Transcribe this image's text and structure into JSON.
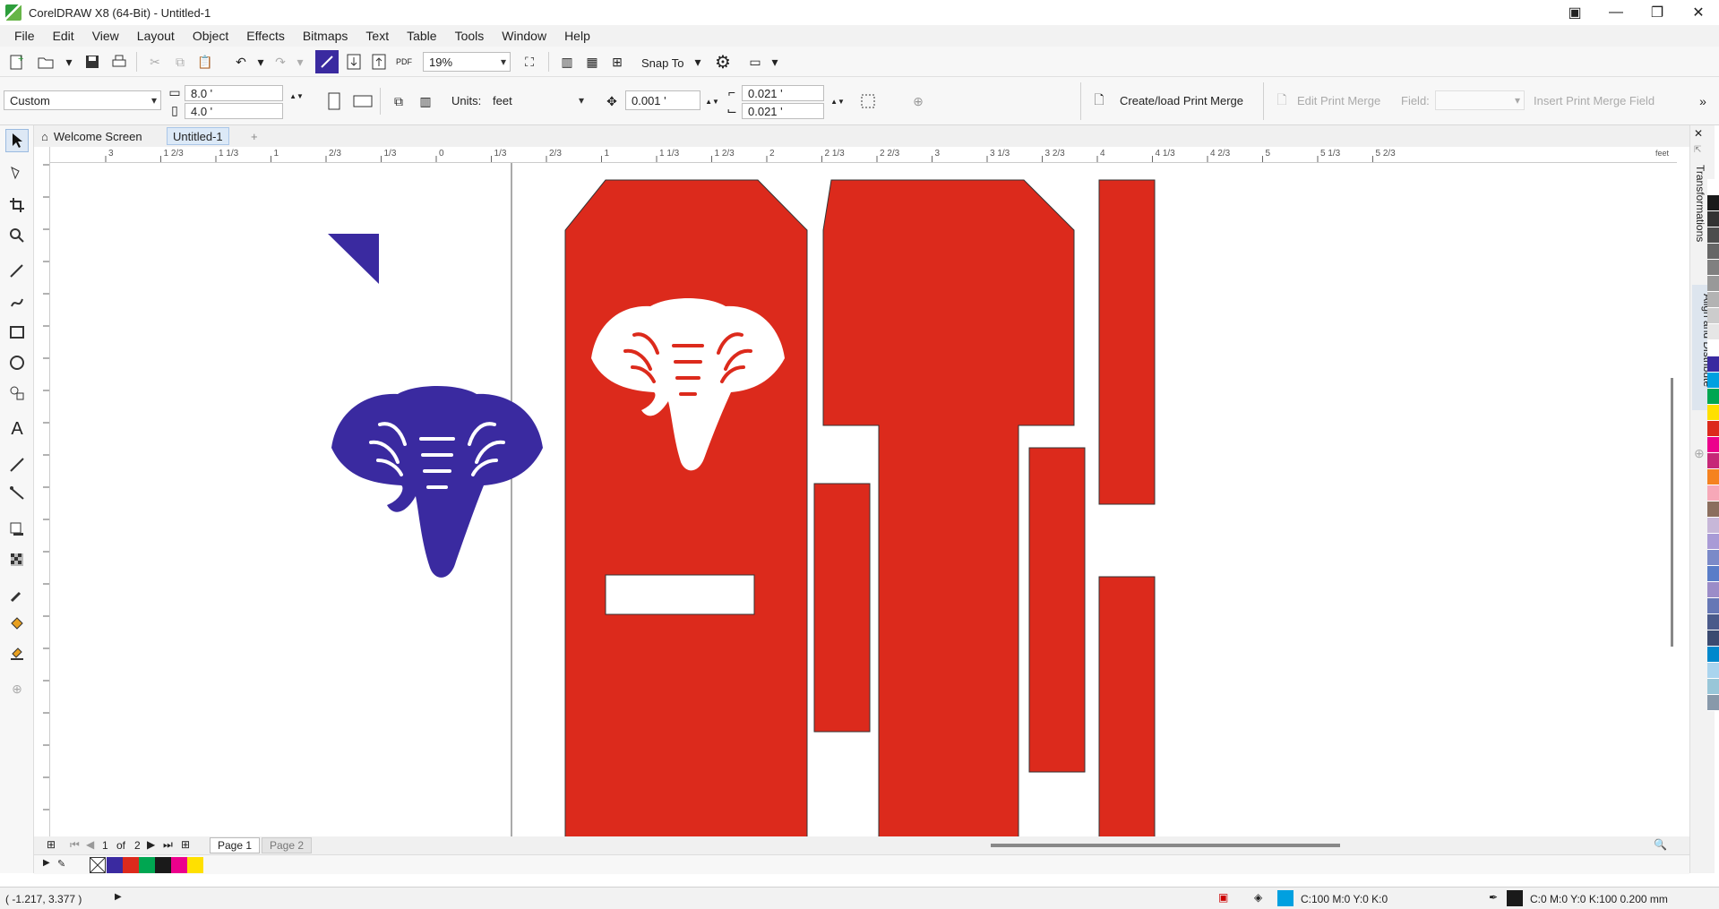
{
  "window": {
    "title": "CorelDRAW X8 (64-Bit) - Untitled-1"
  },
  "menu": [
    "File",
    "Edit",
    "View",
    "Layout",
    "Object",
    "Effects",
    "Bitmaps",
    "Text",
    "Table",
    "Tools",
    "Window",
    "Help"
  ],
  "toolbar": {
    "zoom": "19%",
    "snap_to": "Snap To",
    "pdf_label": "PDF"
  },
  "propertybar": {
    "page_preset": "Custom",
    "width": "8.0 '",
    "height": "4.0 '",
    "units_label": "Units:",
    "units": "feet",
    "nudge": "0.001 '",
    "dup_x": "0.021 '",
    "dup_y": "0.021 '",
    "create_merge": "Create/load Print Merge",
    "edit_merge": "Edit Print Merge",
    "field_label": "Field:",
    "insert_field": "Insert Print Merge Field"
  },
  "tabs": {
    "welcome": "Welcome Screen",
    "doc": "Untitled-1"
  },
  "ruler": {
    "unit": "feet",
    "h_ticks": [
      "3",
      "1 2/3",
      "1 1/3",
      "1",
      "2/3",
      "1/3",
      "0",
      "1/3",
      "2/3",
      "1",
      "1 1/3",
      "1 2/3",
      "2",
      "2 1/3",
      "2 2/3",
      "3",
      "3 1/3",
      "3 2/3",
      "4",
      "4 1/3",
      "4 2/3",
      "5",
      "5 1/3",
      "5 2/3"
    ]
  },
  "dockers": {
    "transformations": "Transformations",
    "align": "Align and Distribute"
  },
  "pages": {
    "current": "1",
    "of_label": "of",
    "total": "2",
    "page1": "Page 1",
    "page2": "Page 2"
  },
  "status": {
    "coords": "( -1.217, 3.377 )",
    "fill": "C:100 M:0 Y:0 K:0",
    "outline": "C:0 M:0 Y:0 K:100  0.200 mm"
  },
  "colors": {
    "red": "#dc2a1c",
    "blue": "#3a2aa0",
    "cyan": "#00a0e0"
  },
  "palette_colors": [
    "#ffffff",
    "#1a1a1a",
    "#333333",
    "#4d4d4d",
    "#666666",
    "#808080",
    "#999999",
    "#b3b3b3",
    "#cccccc",
    "#e6e6e6",
    "#ffffff",
    "#3a2aa0",
    "#00a0e0",
    "#00a651",
    "#ffe000",
    "#dc2a1c",
    "#ec008c",
    "#c62878",
    "#f58220",
    "#f7a8b8",
    "#8b6e5e",
    "#c7b7d8",
    "#a99bd6",
    "#7b8ac8",
    "#5a7dc8",
    "#9b8cc8",
    "#6677b5",
    "#4a5a8a",
    "#3a4a70",
    "#0088cc",
    "#aad4ee",
    "#99c6d8",
    "#8899aa"
  ],
  "doc_palette": [
    "#3a2aa0",
    "#dc2a1c",
    "#00a651",
    "#1a1a1a",
    "#ec008c",
    "#ffe000"
  ]
}
